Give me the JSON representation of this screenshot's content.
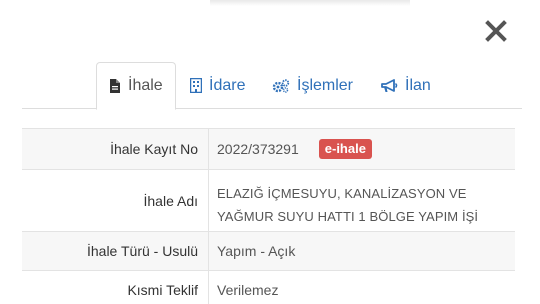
{
  "tabs": [
    {
      "label": "İhale",
      "icon": "document-icon",
      "active": true
    },
    {
      "label": "İdare",
      "icon": "building-icon",
      "active": false
    },
    {
      "label": "İşlemler",
      "icon": "gears-icon",
      "active": false
    },
    {
      "label": "İlan",
      "icon": "megaphone-icon",
      "active": false
    }
  ],
  "details": {
    "kayit_no_label": "İhale Kayıt No",
    "kayit_no_value": "2022/373291",
    "kayit_badge": "e-ihale",
    "adi_label": "İhale Adı",
    "adi_line1": "ELAZIĞ İÇMESUYU, KANALİZASYON VE",
    "adi_line2": "YAĞMUR SUYU HATTI 1 BÖLGE YAPIM İŞİ",
    "turu_label": "İhale Türü - Usulü",
    "turu_value": "Yapım - Açık",
    "kismi_label": "Kısmi Teklif",
    "kismi_value": "Verilemez"
  },
  "colors": {
    "link": "#3071b9",
    "badge": "#d9534f",
    "stripe": "#f7f7f7"
  }
}
